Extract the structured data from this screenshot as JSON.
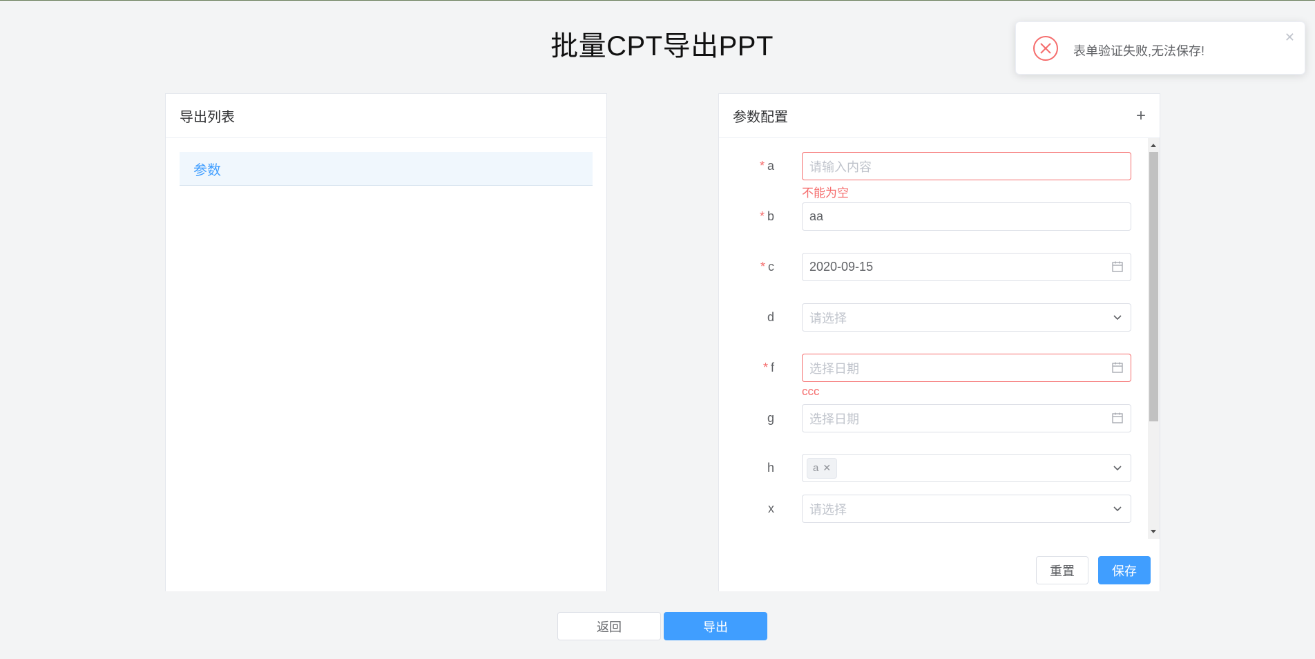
{
  "page": {
    "title": "批量CPT导出PPT"
  },
  "left_panel": {
    "header": "导出列表",
    "items": [
      {
        "label": "参数"
      }
    ]
  },
  "right_panel": {
    "header": "参数配置",
    "add_icon": "+",
    "fields": [
      {
        "label": "a",
        "required": true,
        "type": "input",
        "placeholder": "请输入内容",
        "value": "",
        "error": "不能为空"
      },
      {
        "label": "b",
        "required": true,
        "type": "input",
        "placeholder": "",
        "value": "aa"
      },
      {
        "label": "c",
        "required": true,
        "type": "date",
        "placeholder": "",
        "value": "2020-09-15"
      },
      {
        "label": "d",
        "required": false,
        "type": "select",
        "placeholder": "请选择",
        "value": ""
      },
      {
        "label": "f",
        "required": true,
        "type": "date",
        "placeholder": "选择日期",
        "value": "",
        "error": "ccc"
      },
      {
        "label": "g",
        "required": false,
        "type": "date",
        "placeholder": "选择日期",
        "value": ""
      },
      {
        "label": "h",
        "required": false,
        "type": "multiselect",
        "tags": [
          "a"
        ]
      },
      {
        "label": "x",
        "required": false,
        "type": "select",
        "placeholder": "请选择",
        "value": ""
      }
    ],
    "required_mark": "*",
    "reset_label": "重置",
    "save_label": "保存"
  },
  "footer": {
    "back_label": "返回",
    "export_label": "导出"
  },
  "toast": {
    "message": "表单验证失败,无法保存!",
    "close": "✕"
  },
  "colors": {
    "primary": "#409eff",
    "danger": "#f56c6c",
    "active_bg": "#f0f7fd"
  },
  "icons": {
    "date": "calendar-icon",
    "select": "chevron-down-icon",
    "toast": "error-circle-icon"
  }
}
